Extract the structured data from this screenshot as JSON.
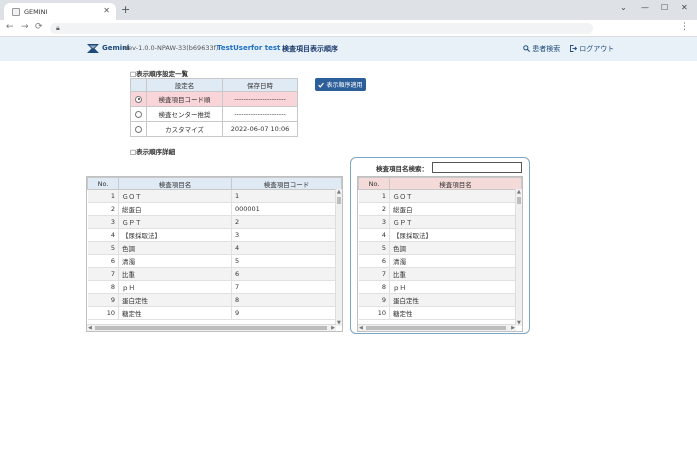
{
  "browser": {
    "tab_title": "GEMINI",
    "tab_close": "✕",
    "new_tab": "+",
    "controls": [
      "⌄",
      "—",
      "☐",
      "✕"
    ],
    "nav": [
      "←",
      "→",
      "⟳"
    ],
    "lock": "🔒︎",
    "menu": "⋮"
  },
  "header": {
    "logo": "Gemini",
    "version": "dev-1.0.0-NPAW-33(b69633f)",
    "user": "TestUser",
    "for": "for test",
    "screen_title": "検査項目表示順序",
    "search_link": "患者検索",
    "logout_link": "ログアウト"
  },
  "settings": {
    "title": "□表示順序設定一覧",
    "columns": [
      "設定名",
      "保存日時"
    ],
    "rows": [
      {
        "name": "検査項目コード順",
        "saved": "----------------------",
        "selected": true
      },
      {
        "name": "検査センター推奨",
        "saved": "----------------------",
        "selected": false
      },
      {
        "name": "カスタマイズ",
        "saved": "2022-06-07 10:06",
        "selected": false
      }
    ],
    "apply_button": "表示順序適用"
  },
  "detail": {
    "title": "□表示順序詳細",
    "left_columns": [
      "No.",
      "検査項目名",
      "検査項目コード"
    ],
    "left_rows": [
      {
        "no": "1",
        "name": "ＧＯＴ",
        "code": "1"
      },
      {
        "no": "2",
        "name": "総蛋白",
        "code": "000001"
      },
      {
        "no": "3",
        "name": "ＧＰＴ",
        "code": "2"
      },
      {
        "no": "4",
        "name": "【尿採取法】",
        "code": "3"
      },
      {
        "no": "5",
        "name": "色調",
        "code": "4"
      },
      {
        "no": "6",
        "name": "清濁",
        "code": "5"
      },
      {
        "no": "7",
        "name": "比重",
        "code": "6"
      },
      {
        "no": "8",
        "name": "ｐＨ",
        "code": "7"
      },
      {
        "no": "9",
        "name": "蛋白定性",
        "code": "8"
      },
      {
        "no": "10",
        "name": "糖定性",
        "code": "9"
      }
    ],
    "search_label": "検査項目名検索：",
    "search_value": "",
    "right_columns": [
      "No.",
      "検査項目名"
    ],
    "right_rows": [
      {
        "no": "1",
        "name": "ＧＯＴ"
      },
      {
        "no": "2",
        "name": "総蛋白"
      },
      {
        "no": "3",
        "name": "ＧＰＴ"
      },
      {
        "no": "4",
        "name": "【尿採取法】"
      },
      {
        "no": "5",
        "name": "色調"
      },
      {
        "no": "6",
        "name": "清濁"
      },
      {
        "no": "7",
        "name": "比重"
      },
      {
        "no": "8",
        "name": "ｐＨ"
      },
      {
        "no": "9",
        "name": "蛋白定性"
      },
      {
        "no": "10",
        "name": "糖定性"
      }
    ]
  },
  "colors": {
    "header_bg": "#e8f1f8",
    "selected_row": "#f9d4d8",
    "button": "#2c5f99",
    "left_header": "#dfeaf4",
    "right_header": "#f5dada"
  }
}
